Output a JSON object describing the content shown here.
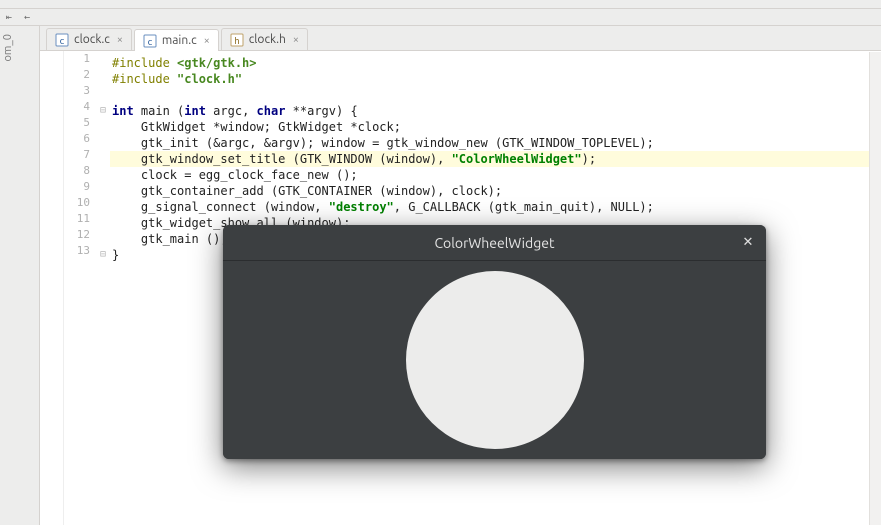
{
  "toolbar": {
    "btn1_glyph": "⇤",
    "btn2_glyph": "←"
  },
  "sidebar": {
    "label": "om_0"
  },
  "tabs": [
    {
      "name": "clock.c",
      "icon": "c",
      "active": false
    },
    {
      "name": "main.c",
      "icon": "c",
      "active": true
    },
    {
      "name": "clock.h",
      "icon": "h",
      "active": false
    }
  ],
  "editor": {
    "highlighted_line": 7,
    "lines": [
      {
        "n": 1,
        "fold": "",
        "tokens": [
          {
            "t": "#include ",
            "c": "pp"
          },
          {
            "t": "<gtk/gtk.h>",
            "c": "inc"
          }
        ]
      },
      {
        "n": 2,
        "fold": "",
        "tokens": [
          {
            "t": "#include ",
            "c": "pp"
          },
          {
            "t": "\"clock.h\"",
            "c": "inc"
          }
        ]
      },
      {
        "n": 3,
        "fold": "",
        "tokens": []
      },
      {
        "n": 4,
        "fold": "⊟",
        "tokens": [
          {
            "t": "int ",
            "c": "kw"
          },
          {
            "t": "main (",
            "c": ""
          },
          {
            "t": "int ",
            "c": "kw"
          },
          {
            "t": "argc, ",
            "c": ""
          },
          {
            "t": "char ",
            "c": "kw"
          },
          {
            "t": "**argv) {",
            "c": ""
          }
        ]
      },
      {
        "n": 5,
        "fold": "",
        "tokens": [
          {
            "t": "    GtkWidget *window; GtkWidget *clock;",
            "c": ""
          }
        ]
      },
      {
        "n": 6,
        "fold": "",
        "tokens": [
          {
            "t": "    gtk_init (&argc, &argv); window = gtk_window_new (GTK_WINDOW_TOPLEVEL);",
            "c": ""
          }
        ]
      },
      {
        "n": 7,
        "fold": "",
        "tokens": [
          {
            "t": "    gtk_window_set_title (GTK_WINDOW (window), ",
            "c": ""
          },
          {
            "t": "\"ColorWheelWidget\"",
            "c": "str"
          },
          {
            "t": ");",
            "c": ""
          }
        ]
      },
      {
        "n": 8,
        "fold": "",
        "tokens": [
          {
            "t": "    clock = egg_clock_face_new ();",
            "c": ""
          }
        ]
      },
      {
        "n": 9,
        "fold": "",
        "tokens": [
          {
            "t": "    gtk_container_add (GTK_CONTAINER (window), clock);",
            "c": ""
          }
        ]
      },
      {
        "n": 10,
        "fold": "",
        "tokens": [
          {
            "t": "    g_signal_connect (window, ",
            "c": ""
          },
          {
            "t": "\"destroy\"",
            "c": "str"
          },
          {
            "t": ", G_CALLBACK (gtk_main_quit), NULL);",
            "c": ""
          }
        ]
      },
      {
        "n": 11,
        "fold": "",
        "tokens": [
          {
            "t": "    gtk_widget_show_all (window);",
            "c": ""
          }
        ]
      },
      {
        "n": 12,
        "fold": "",
        "tokens": [
          {
            "t": "    gtk_main ();",
            "c": ""
          }
        ]
      },
      {
        "n": 13,
        "fold": "⊟",
        "tokens": [
          {
            "t": "}",
            "c": ""
          }
        ]
      }
    ]
  },
  "gtk_window": {
    "title": "ColorWheelWidget"
  }
}
